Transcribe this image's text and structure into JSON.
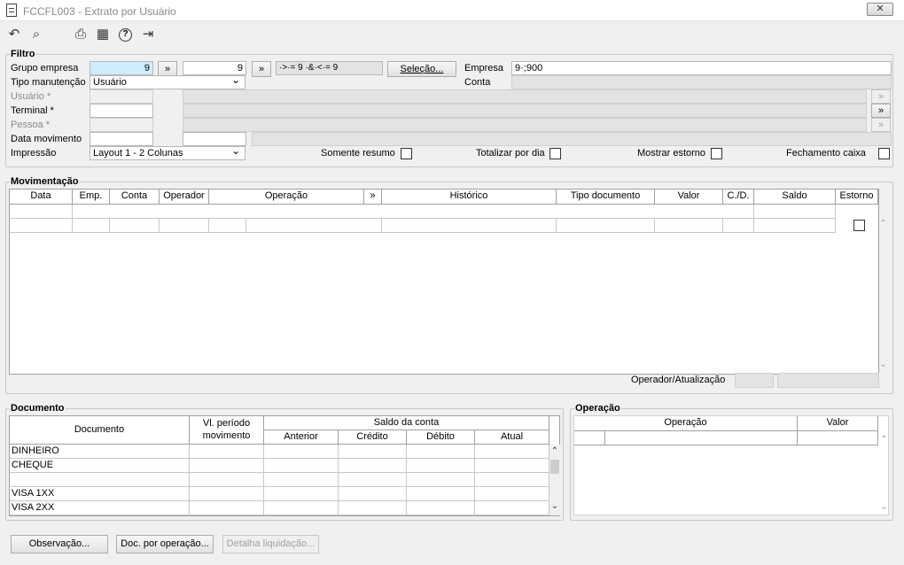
{
  "window": {
    "title": "FCCFL003 - Extrato por Usuário",
    "close_icon": "close-icon"
  },
  "toolbar": {
    "undo_icon": "↶",
    "search_icon": "⌕",
    "print_icon": "⎙",
    "calendar_icon": "▦",
    "help_icon": "?",
    "exit_icon": "⇥"
  },
  "filtro": {
    "group_label": "Filtro",
    "grupo_empresa_label": "Grupo empresa",
    "grupo_empresa_from": "9",
    "grupo_empresa_to": "9",
    "expand_label": "»",
    "grupo_expression": "·>·= 9 ·&·<·= 9",
    "selecao_label": "Seleção...",
    "empresa_label": "Empresa",
    "empresa_value": "9·;900",
    "conta_label": "Conta",
    "tipo_manutencao_label": "Tipo manutenção",
    "tipo_manutencao_value": "Usuário",
    "usuario_label": "Usuário *",
    "terminal_label": "Terminal *",
    "pessoa_label": "Pessoa *",
    "data_movimento_label": "Data movimento",
    "impressao_label": "Impressão",
    "impressao_value": "Layout 1 - 2 Colunas",
    "somente_resumo_label": "Somente resumo",
    "totalizar_por_dia_label": "Totalizar por dia",
    "mostrar_estorno_label": "Mostrar estorno",
    "fechamento_caixa_label": "Fechamento caixa"
  },
  "movimentacao": {
    "group_label": "Movimentação",
    "columns": [
      "Data",
      "Emp.",
      "Conta",
      "Operador",
      "Operação",
      "»",
      "Histórico",
      "Tipo documento",
      "Valor",
      "C./D.",
      "Saldo",
      "Estorno"
    ],
    "operador_atualizacao_label": "Operador/Atualização"
  },
  "documento": {
    "group_label": "Documento",
    "col_documento": "Documento",
    "col_vl_periodo": "Vl. período movimento",
    "col_saldo": "Saldo da conta",
    "sub_cols": [
      "Anterior",
      "Crédito",
      "Débito",
      "Atual"
    ],
    "rows": [
      "DINHEIRO",
      "CHEQUE",
      "",
      "VISA 1XX",
      "VISA 2XX"
    ]
  },
  "operacao": {
    "group_label": "Operação",
    "columns": [
      "Operação",
      "Valor"
    ]
  },
  "footer": {
    "observacao_label": "Observação...",
    "doc_por_operacao_label": "Doc. por operação...",
    "detalha_liquidacao_label": "Detalha liquidação..."
  }
}
